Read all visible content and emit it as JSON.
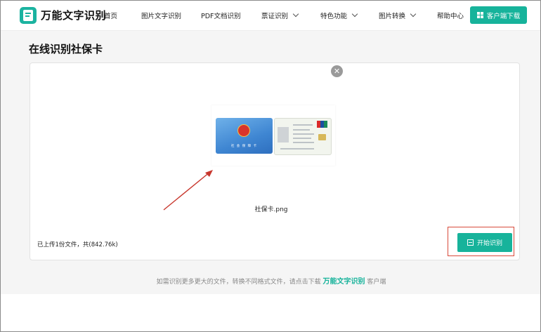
{
  "brand": {
    "name": "万能文字识别"
  },
  "nav": {
    "items": [
      {
        "label": "首页",
        "dropdown": false
      },
      {
        "label": "图片文字识别",
        "dropdown": false
      },
      {
        "label": "PDF文档识别",
        "dropdown": false
      },
      {
        "label": "票证识别",
        "dropdown": true
      },
      {
        "label": "特色功能",
        "dropdown": true
      },
      {
        "label": "图片转换",
        "dropdown": true
      },
      {
        "label": "帮助中心",
        "dropdown": false
      }
    ],
    "download_label": "客户端下载"
  },
  "page": {
    "title": "在线识别社保卡"
  },
  "upload": {
    "file_name": "社保卡.png",
    "status": "已上传1份文件，共(842.76k)",
    "close_symbol": "✕",
    "thumbnail": {
      "front_title": "社 会 保 障 卡"
    }
  },
  "actions": {
    "start_label": "开始识别"
  },
  "footer": {
    "prefix": "如需识别更多更大的文件，转换不同格式文件，请点击下载",
    "brand_link": "万能文字识别",
    "suffix": "客户端"
  },
  "colors": {
    "accent": "#17b39b",
    "highlight": "#d84a3a"
  }
}
